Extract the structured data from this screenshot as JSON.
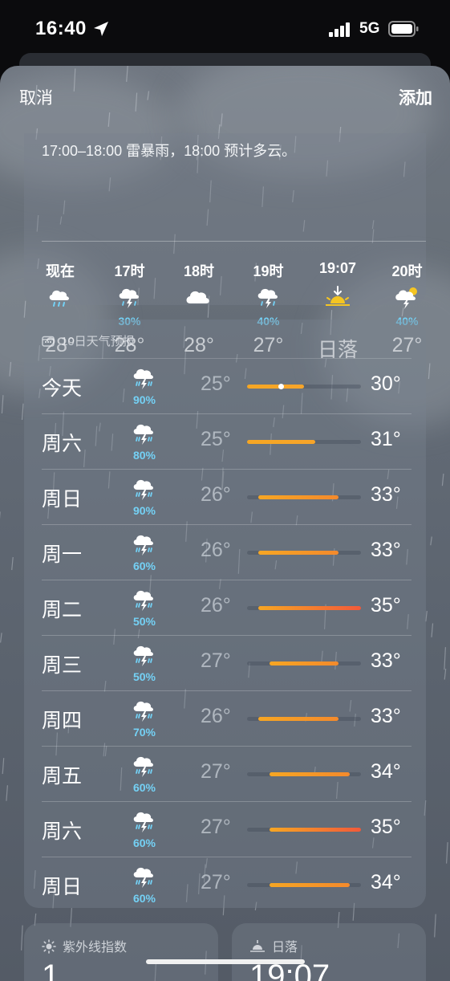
{
  "status_bar": {
    "time": "16:40",
    "network": "5G"
  },
  "nav": {
    "cancel": "取消",
    "add": "添加"
  },
  "hourly": {
    "summary": "17:00–18:00 雷暴雨，18:00 预计多云。",
    "items": [
      {
        "label": "现在",
        "icon": "cloud-rain-icon",
        "pop": "",
        "temp": "28°"
      },
      {
        "label": "17时",
        "icon": "cloud-bolt-icon",
        "pop": "30%",
        "temp": "28°"
      },
      {
        "label": "18时",
        "icon": "cloud-icon",
        "pop": "",
        "temp": "28°"
      },
      {
        "label": "19时",
        "icon": "cloud-bolt-icon",
        "pop": "40%",
        "temp": "27°"
      },
      {
        "label": "19:07",
        "icon": "sunset-icon",
        "pop": "",
        "temp": "日落"
      },
      {
        "label": "20时",
        "icon": "cloud-sun-icon",
        "pop": "40%",
        "temp": "27°"
      }
    ]
  },
  "daily": {
    "header": "10日天气预报",
    "scale_min": 25,
    "scale_max": 35,
    "days": [
      {
        "name": "今天",
        "pop": "90%",
        "low": "25°",
        "high": "30°",
        "low_v": 25,
        "high_v": 30,
        "current_v": 28
      },
      {
        "name": "周六",
        "pop": "80%",
        "low": "25°",
        "high": "31°",
        "low_v": 25,
        "high_v": 31
      },
      {
        "name": "周日",
        "pop": "90%",
        "low": "26°",
        "high": "33°",
        "low_v": 26,
        "high_v": 33
      },
      {
        "name": "周一",
        "pop": "60%",
        "low": "26°",
        "high": "33°",
        "low_v": 26,
        "high_v": 33
      },
      {
        "name": "周二",
        "pop": "50%",
        "low": "26°",
        "high": "35°",
        "low_v": 26,
        "high_v": 35
      },
      {
        "name": "周三",
        "pop": "50%",
        "low": "27°",
        "high": "33°",
        "low_v": 27,
        "high_v": 33
      },
      {
        "name": "周四",
        "pop": "70%",
        "low": "26°",
        "high": "33°",
        "low_v": 26,
        "high_v": 33
      },
      {
        "name": "周五",
        "pop": "60%",
        "low": "27°",
        "high": "34°",
        "low_v": 27,
        "high_v": 34
      },
      {
        "name": "周六",
        "pop": "60%",
        "low": "27°",
        "high": "35°",
        "low_v": 27,
        "high_v": 35
      },
      {
        "name": "周日",
        "pop": "60%",
        "low": "27°",
        "high": "34°",
        "low_v": 27,
        "high_v": 34
      }
    ]
  },
  "tiles": {
    "uv": {
      "label": "紫外线指数",
      "value": "1"
    },
    "sunset": {
      "label": "日落",
      "value": "19:07"
    }
  },
  "colors": {
    "precip": "#74d1f5",
    "bar_orange": "#f6a623",
    "bar_red": "#f25a3a"
  }
}
